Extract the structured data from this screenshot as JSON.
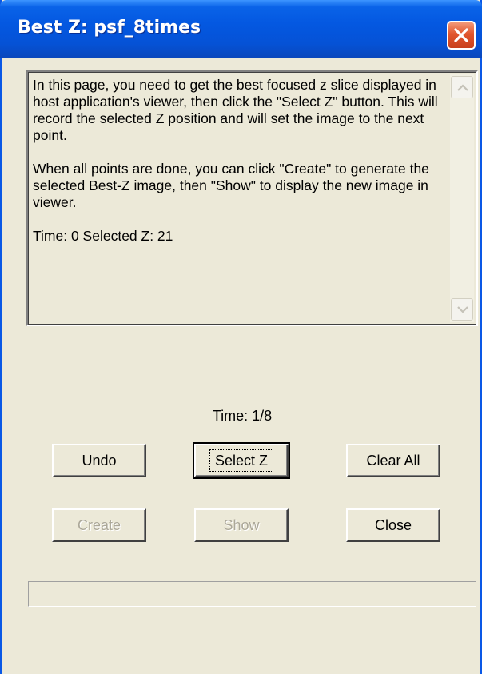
{
  "window": {
    "title": "Best Z: psf_8times"
  },
  "info": {
    "paragraph1": "In this page, you need to get the best focused z slice displayed in host application's viewer, then click the \"Select Z\" button.  This will record the selected Z position and will set the image to the next point.",
    "paragraph2": "When all points are done, you can click \"Create\" to generate the selected Best-Z image, then \"Show\" to display the new image in viewer.",
    "status": "Time: 0  Selected Z: 21"
  },
  "time_label": "Time: 1/8",
  "buttons": {
    "undo": "Undo",
    "select_z": "Select Z",
    "clear_all": "Clear All",
    "create": "Create",
    "show": "Show",
    "close": "Close"
  },
  "progress": {
    "value": 0
  },
  "colors": {
    "titlebar": "#0458e1",
    "close_button": "#e1552d",
    "dialog_background": "#ece9d8",
    "disabled_text": "#aca899"
  }
}
